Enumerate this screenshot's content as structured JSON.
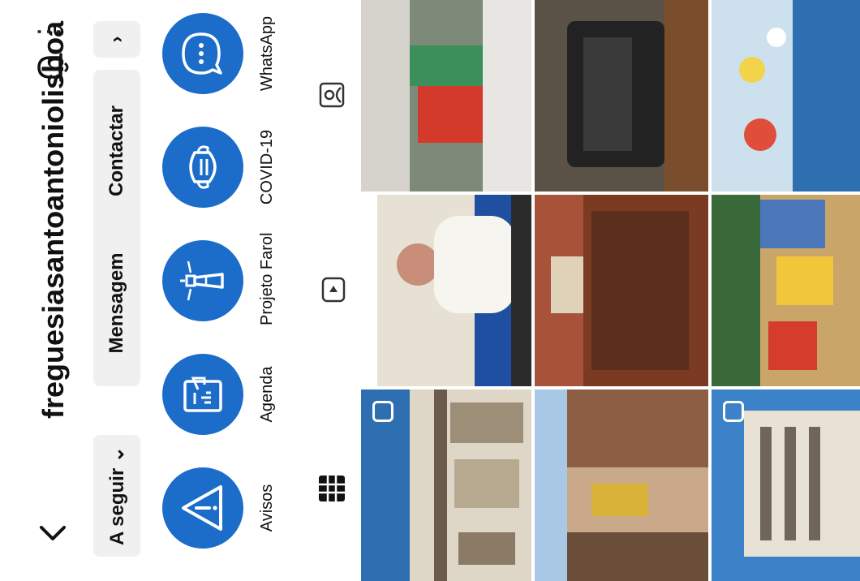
{
  "profile": {
    "username": "freguesiasantoantoniolisboa"
  },
  "buttons": {
    "following": "A seguir ⌄",
    "message": "Mensagem",
    "contact": "Contactar",
    "more_chevron": "›"
  },
  "highlights": [
    {
      "label": "Avisos",
      "icon": "warning-icon"
    },
    {
      "label": "Agenda",
      "icon": "agenda-icon"
    },
    {
      "label": "Projeto Farol",
      "icon": "lighthouse-icon"
    },
    {
      "label": "COVID-19",
      "icon": "mask-icon"
    },
    {
      "label": "WhatsApp",
      "icon": "chat-icon"
    }
  ],
  "tabs": [
    "grid-icon",
    "reels-icon",
    "tagged-icon"
  ],
  "colors": {
    "accent": "#1b6dc9",
    "button_bg": "#f0f0f0"
  },
  "posts": [
    {
      "name": "post-street-blue-sky",
      "multi": true,
      "color": "#2d6fb0"
    },
    {
      "name": "post-man-speaking",
      "multi": false,
      "color": "#e7e1d4"
    },
    {
      "name": "post-people-stall",
      "multi": false,
      "color": "#7d8a7a"
    },
    {
      "name": "post-alley-colorful",
      "multi": false,
      "color": "#6a4e3a"
    },
    {
      "name": "post-theater-seats",
      "multi": false,
      "color": "#7a3b22"
    },
    {
      "name": "post-typewriter",
      "multi": false,
      "color": "#5a5147"
    },
    {
      "name": "post-building-blue-sky",
      "multi": true,
      "color": "#3b82c8"
    },
    {
      "name": "post-colorful-market",
      "multi": false,
      "color": "#c9a56a"
    },
    {
      "name": "post-balloons",
      "multi": false,
      "color": "#cde0ee"
    }
  ]
}
